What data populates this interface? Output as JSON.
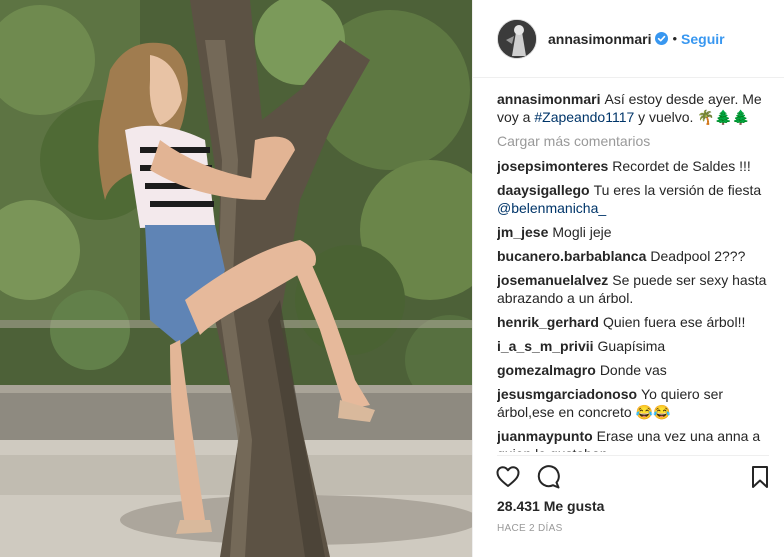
{
  "post": {
    "author": "annasimonmari",
    "follow_label": "Seguir",
    "separator": "•",
    "caption": {
      "user": "annasimonmari",
      "text_before": "Así estoy desde ayer. Me voy a",
      "hashtag": "#Zapeando1117",
      "text_after": "y vuelvo. 🌴🌲🌲"
    },
    "load_more_label": "Cargar más comentarios",
    "likes": "28.431 Me gusta",
    "timestamp": "HACE 2 DÍAS"
  },
  "comments": [
    {
      "user": "josepsimonteres",
      "text": "Recordet de Saldes !!!"
    },
    {
      "user": "daaysigallego",
      "text": "Tu eres la versión de fiesta",
      "mention": "@belenmanicha_"
    },
    {
      "user": "jm_jese",
      "text": "Mogli jeje"
    },
    {
      "user": "bucanero.barbablanca",
      "text": "Deadpool 2???"
    },
    {
      "user": "josemanuelalvez",
      "text": "Se puede ser sexy hasta abrazando a un árbol."
    },
    {
      "user": "henrik_gerhard",
      "text": "Quien fuera ese árbol!!"
    },
    {
      "user": "i_a_s_m_privii",
      "text": "Guapísima"
    },
    {
      "user": "gomezalmagro",
      "text": "Donde vas"
    },
    {
      "user": "jesusmgarciadonoso",
      "text": "Yo quiero ser árbol,ese en concreto 😂😂"
    },
    {
      "user": "juanmaypunto",
      "text": "Erase una vez una anna a quien le gustaban"
    }
  ],
  "icons": {
    "like": "heart-outline-icon",
    "comment": "speech-bubble-icon",
    "save": "bookmark-icon",
    "verified": "verified-badge-icon"
  },
  "colors": {
    "accent": "#3897f0",
    "hashtag": "#003569",
    "muted": "#999999"
  }
}
